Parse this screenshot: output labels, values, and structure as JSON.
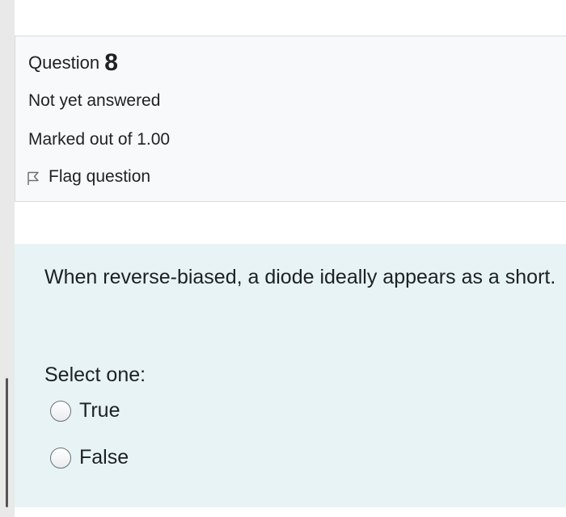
{
  "question": {
    "label": "Question",
    "number": "8",
    "state": "Not yet answered",
    "grade": "Marked out of 1.00",
    "flag_label": "Flag question"
  },
  "content": {
    "text": "When reverse-biased, a diode ideally appears as a short.",
    "prompt": "Select one:",
    "options": [
      {
        "label": "True",
        "selected": false
      },
      {
        "label": "False",
        "selected": false
      }
    ]
  }
}
